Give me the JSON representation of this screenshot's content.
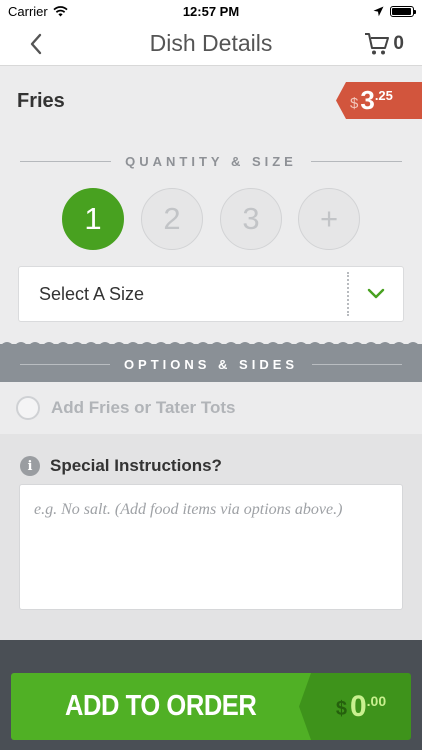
{
  "status_bar": {
    "carrier": "Carrier",
    "time": "12:57 PM",
    "battery_level": 0.95
  },
  "nav": {
    "title": "Dish Details",
    "cart_count": "0"
  },
  "dish": {
    "name": "Fries",
    "price_currency": "$",
    "price_whole": "3",
    "price_cents": ".25"
  },
  "quantity_section": {
    "heading": "QUANTITY & SIZE",
    "options": [
      "1",
      "2",
      "3",
      "+"
    ],
    "selected": "1",
    "size_label": "Select A Size"
  },
  "options_section": {
    "heading": "OPTIONS & SIDES",
    "items": [
      {
        "label": "Add Fries or Tater Tots",
        "selected": false
      }
    ]
  },
  "special": {
    "title": "Special Instructions?",
    "placeholder": "e.g. No salt. (Add food items via options above.)"
  },
  "footer": {
    "button_label": "ADD TO ORDER",
    "total_currency": "$",
    "total_whole": "0",
    "total_cents": ".00"
  },
  "colors": {
    "accent_green": "#48a120",
    "price_tag": "#d2553d",
    "band_gray": "#8a9096"
  }
}
